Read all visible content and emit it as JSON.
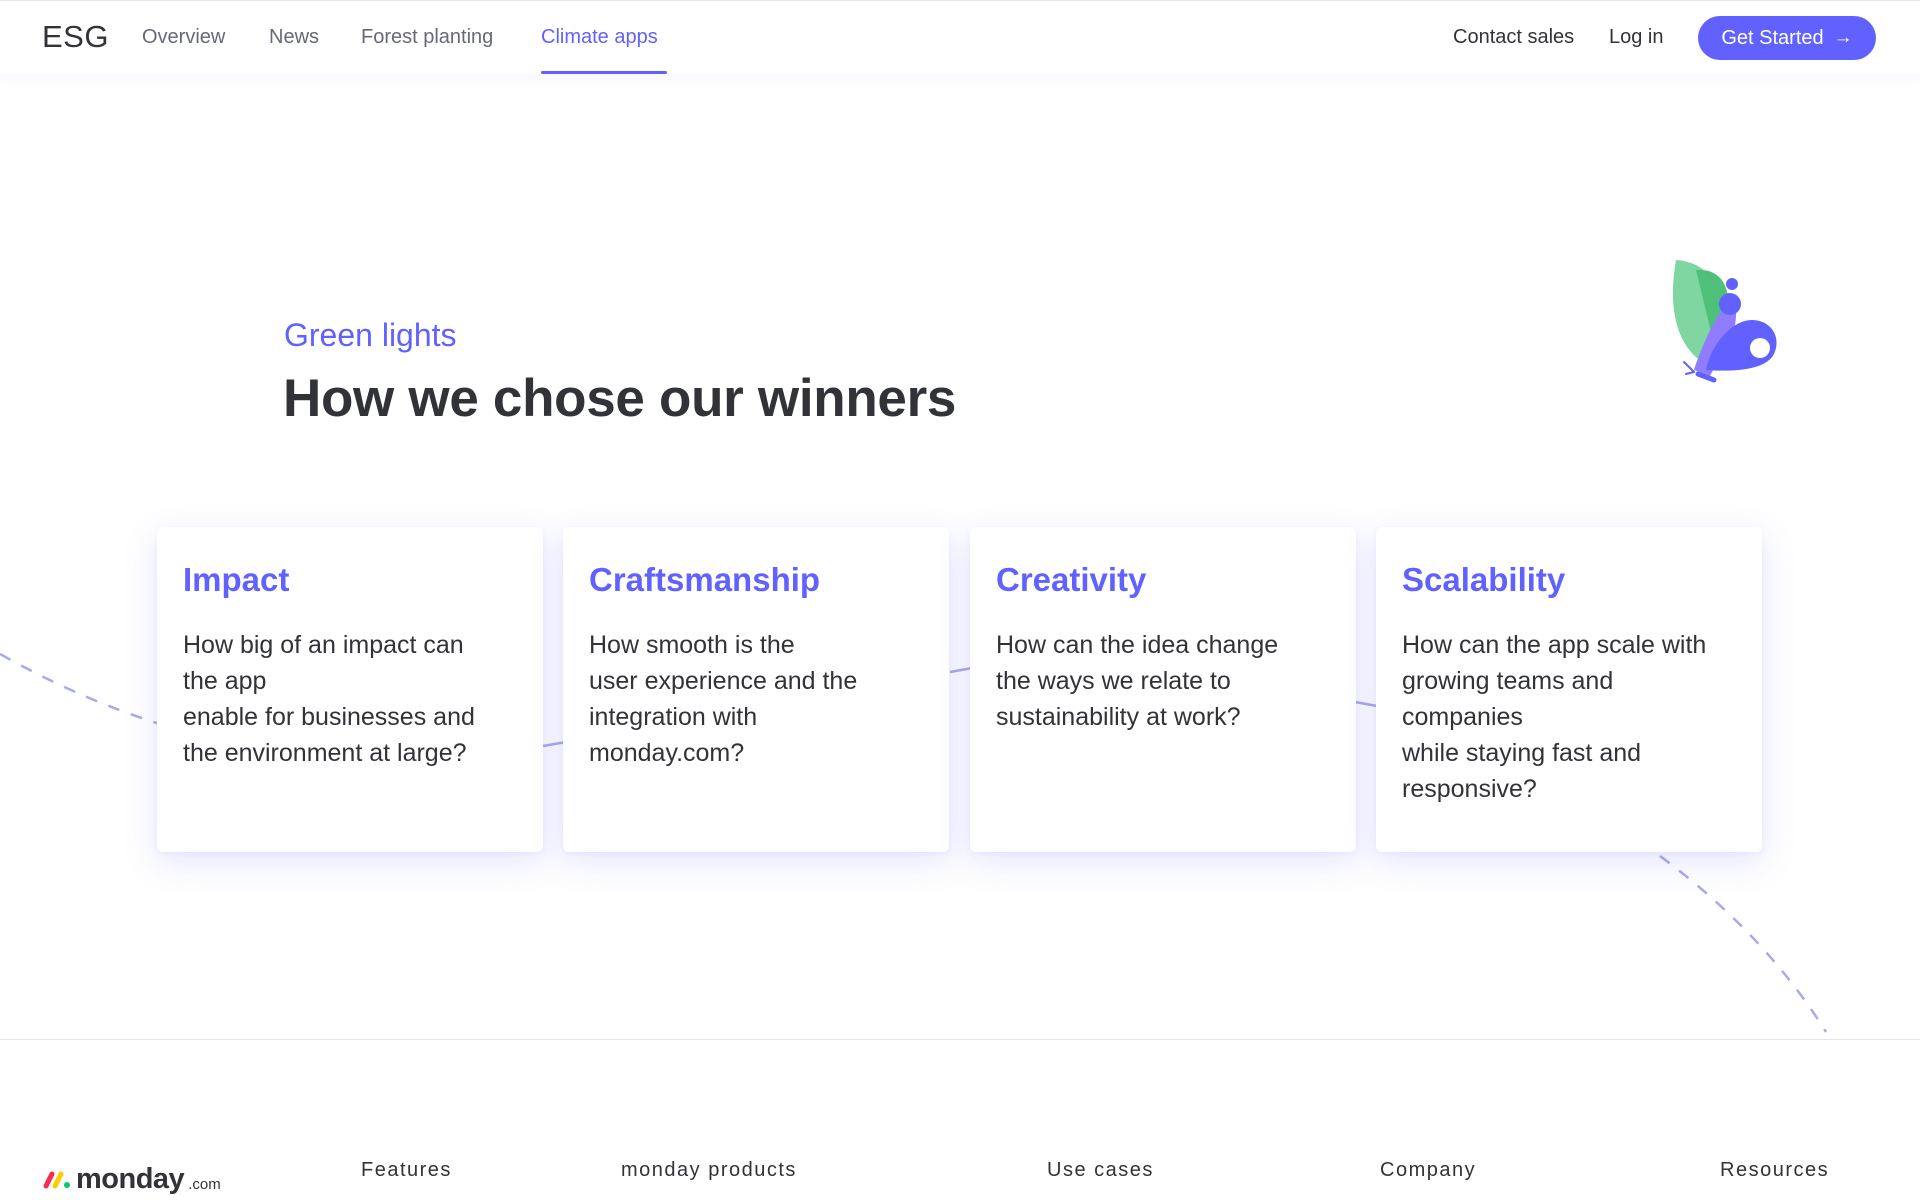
{
  "header": {
    "brand": "ESG",
    "nav": [
      {
        "label": "Overview",
        "active": false
      },
      {
        "label": "News",
        "active": false
      },
      {
        "label": "Forest planting",
        "active": false
      },
      {
        "label": "Climate apps",
        "active": true
      }
    ],
    "contact_sales": "Contact sales",
    "login": "Log in",
    "cta": {
      "label": "Get Started",
      "icon": "arrow-right-icon"
    }
  },
  "section": {
    "eyebrow": "Green lights",
    "title": "How we chose our winners",
    "illustration": "butterfly-icon",
    "cards": [
      {
        "title": "Impact",
        "lines": [
          "How big of an impact can",
          "the app",
          "enable for businesses and",
          "the environment at large?"
        ]
      },
      {
        "title": "Craftsmanship",
        "lines": [
          "How smooth is the",
          "user experience and the",
          "integration with",
          "monday.com?"
        ]
      },
      {
        "title": "Creativity",
        "lines": [
          "How can the idea change",
          "the ways we relate to",
          "sustainability at work?"
        ]
      },
      {
        "title": "Scalability",
        "lines": [
          "How can the app scale with",
          "growing teams and",
          "companies",
          "while staying fast and",
          "responsive?"
        ]
      }
    ]
  },
  "footer": {
    "logo": {
      "word": "monday",
      "suffix": ".com"
    },
    "columns": [
      "Features",
      "monday products",
      "Use cases",
      "Company",
      "Resources"
    ]
  },
  "colors": {
    "accent": "#6161ff",
    "text": "#323338",
    "muted": "#676879",
    "butterfly_green": "#5cc98a",
    "butterfly_purple": "#6161ff",
    "logo_red": "#f62b54",
    "logo_yellow": "#ffcc00",
    "logo_green": "#00ca72"
  }
}
